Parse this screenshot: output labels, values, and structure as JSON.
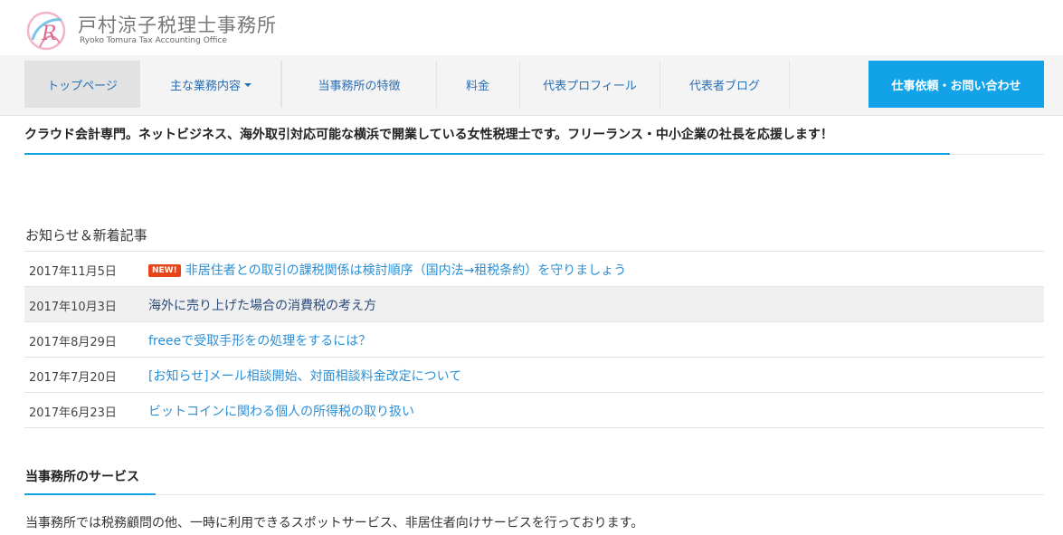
{
  "header": {
    "title": "戸村涼子税理士事務所",
    "subtitle": "Ryoko Tomura Tax Accounting Office"
  },
  "nav": {
    "items": [
      {
        "label": "トップページ"
      },
      {
        "label": "主な業務内容"
      },
      {
        "label": "当事務所の特徴"
      },
      {
        "label": "料金"
      },
      {
        "label": "代表プロフィール"
      },
      {
        "label": "代表者ブログ"
      }
    ],
    "cta": "仕事依頼・お問い合わせ"
  },
  "tagline": "クラウド会計専門。ネットビジネス、海外取引対応可能な横浜で開業している女性税理士です。フリーランス・中小企業の社長を応援します！",
  "news": {
    "heading": "お知らせ＆新着記事",
    "badge": "NEW!",
    "items": [
      {
        "date": "2017年11月5日",
        "title": "非居住者との取引の課税関係は検討順序（国内法→租税条約）を守りましょう"
      },
      {
        "date": "2017年10月3日",
        "title": "海外に売り上げた場合の消費税の考え方"
      },
      {
        "date": "2017年8月29日",
        "title": "freeeで受取手形をの処理をするには？"
      },
      {
        "date": "2017年7月20日",
        "title": "[お知らせ]メール相談開始、対面相談料金改定について"
      },
      {
        "date": "2017年6月23日",
        "title": "ビットコインに関わる個人の所得税の取り扱い"
      }
    ]
  },
  "services": {
    "heading": "当事務所のサービス",
    "text": "当事務所では税務顧問の他、一時に利用できるスポットサービス、非居住者向けサービスを行っております。"
  },
  "colors": {
    "accent": "#11a2e8",
    "link": "#2b8fd6",
    "badge": "#e8441a"
  }
}
